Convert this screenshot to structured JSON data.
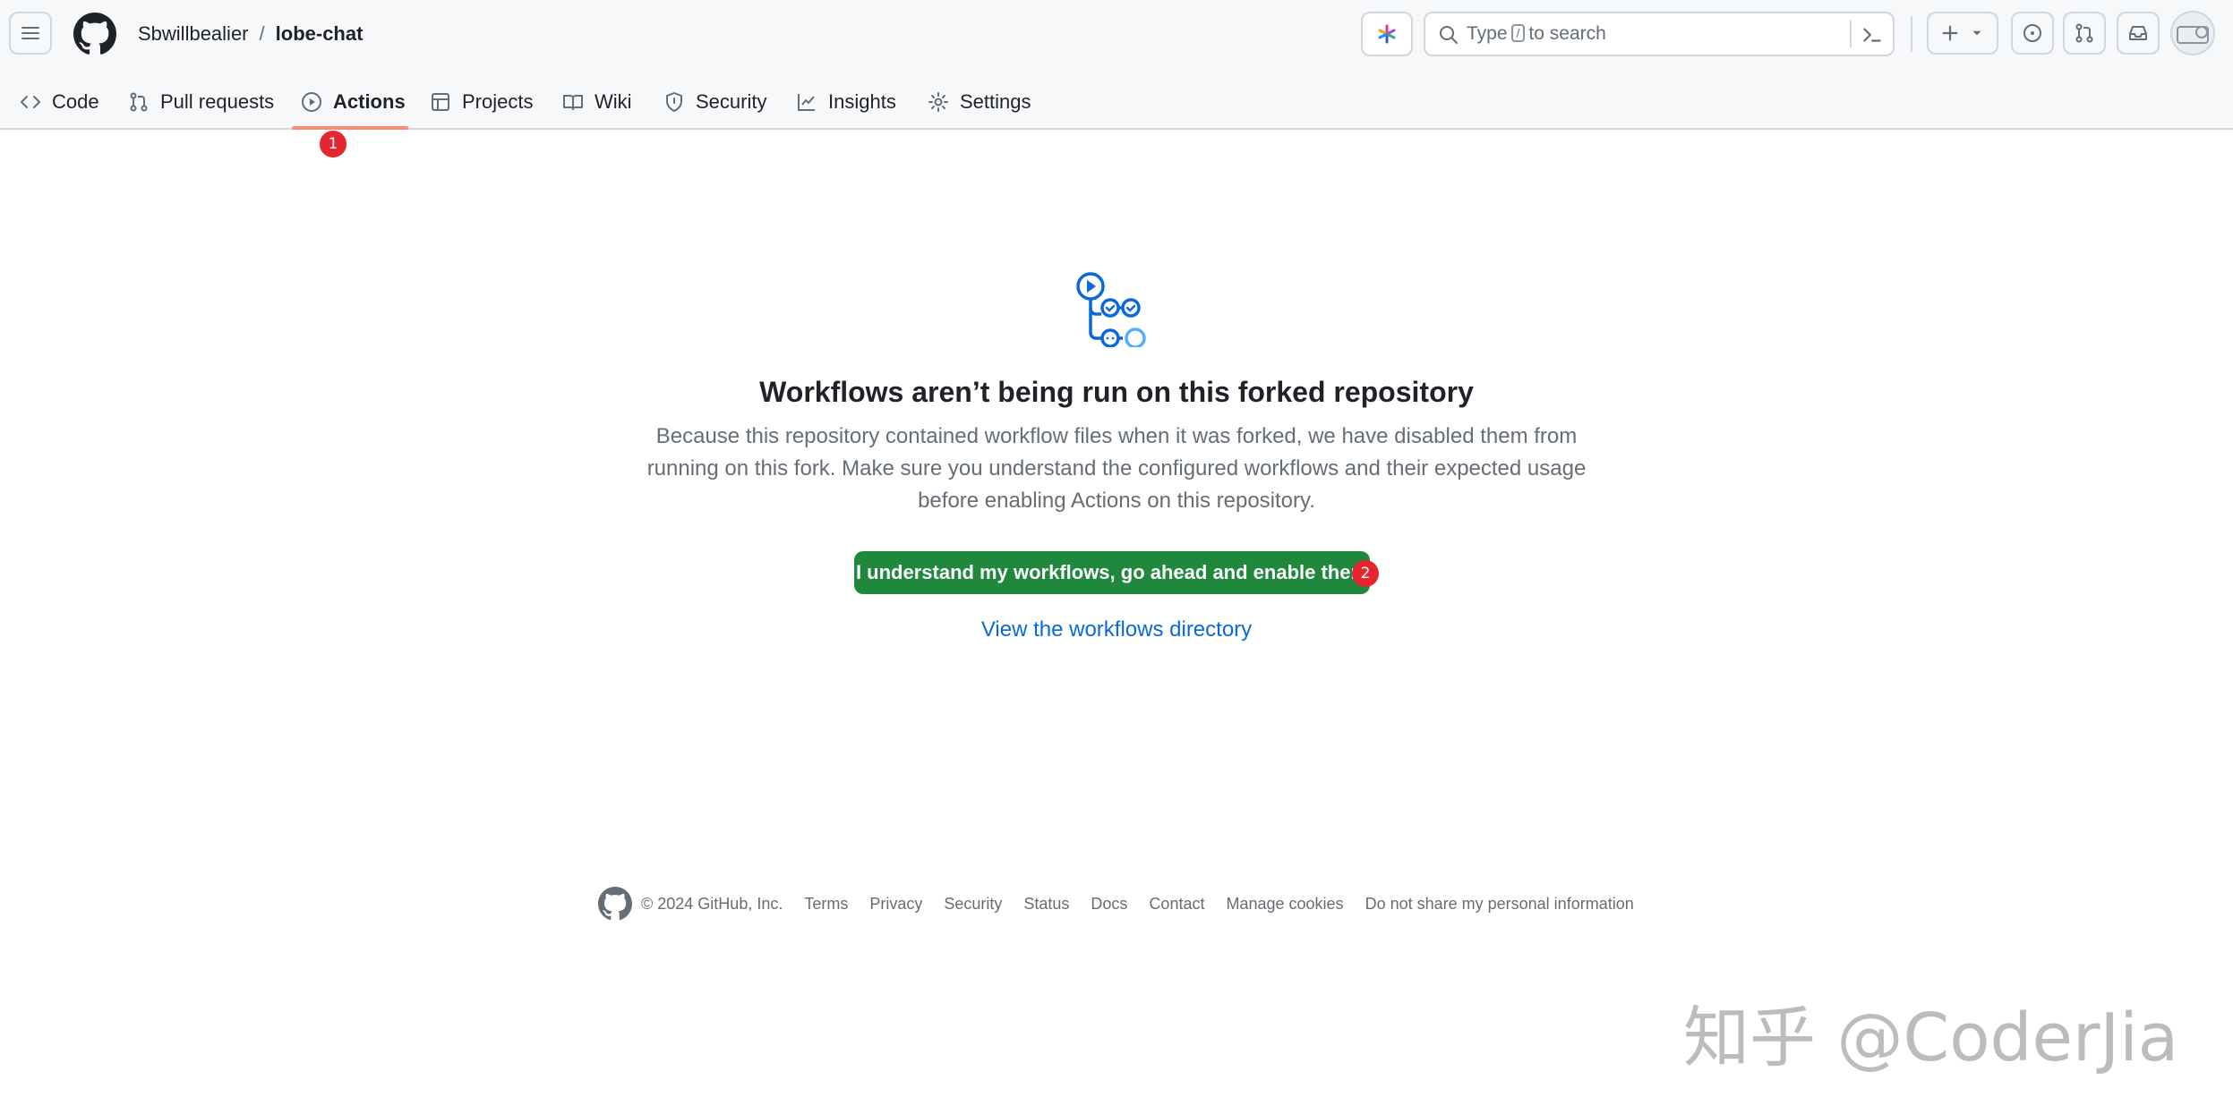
{
  "header": {
    "owner": "Sbwillbealier",
    "separator": "/",
    "repo": "lobe-chat",
    "search": {
      "prefix": "Type",
      "key": "/",
      "suffix": "to search"
    },
    "icons": [
      "hamburger-icon",
      "github-logo",
      "copilot-icon",
      "search-icon",
      "terminal-icon",
      "plus-icon",
      "chevron-down-icon",
      "issues-icon",
      "pull-request-icon",
      "inbox-icon",
      "avatar"
    ]
  },
  "nav": {
    "items": [
      {
        "label": "Code",
        "icon": "code-icon"
      },
      {
        "label": "Pull requests",
        "icon": "pull-request-icon"
      },
      {
        "label": "Actions",
        "icon": "play-icon",
        "active": true
      },
      {
        "label": "Projects",
        "icon": "table-icon"
      },
      {
        "label": "Wiki",
        "icon": "book-icon"
      },
      {
        "label": "Security",
        "icon": "shield-icon"
      },
      {
        "label": "Insights",
        "icon": "graph-icon"
      },
      {
        "label": "Settings",
        "icon": "gear-icon"
      }
    ],
    "active_color": "#fd8c73"
  },
  "annotations": {
    "marker1": "1",
    "marker2": "2",
    "color": "#e5262f"
  },
  "main": {
    "title": "Workflows aren’t being run on this forked repository",
    "description": "Because this repository contained workflow files when it was forked, we have disabled them from running on this fork. Make sure you understand the configured workflows and their expected usage before enabling Actions on this repository.",
    "enable_button": "I understand my workflows, go ahead and enable them",
    "enable_button_color": "#1f883d",
    "directory_link": "View the workflows directory",
    "link_color": "#0969da"
  },
  "footer": {
    "copyright": "© 2024 GitHub, Inc.",
    "links": [
      "Terms",
      "Privacy",
      "Security",
      "Status",
      "Docs",
      "Contact",
      "Manage cookies",
      "Do not share my personal information"
    ]
  },
  "watermark": "知乎 @CoderJia"
}
